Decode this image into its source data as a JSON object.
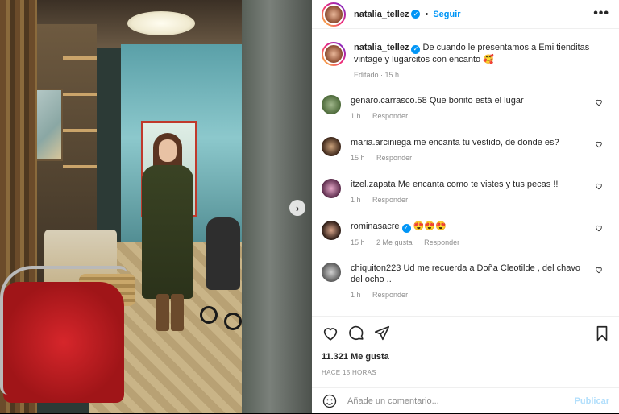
{
  "post": {
    "author": "natalia_tellez",
    "follow_label": "Seguir",
    "more_label": "•••",
    "caption": {
      "author": "natalia_tellez",
      "text": "De cuando le presentamos a Emi tienditas vintage y lugarcitos con encanto 🥰",
      "meta": "Editado · 15 h"
    }
  },
  "comments": [
    {
      "user": "genaro.carrasco.58",
      "text": "Que bonito está el lugar",
      "time": "1 h",
      "likes": "",
      "reply": "Responder",
      "verified": false
    },
    {
      "user": "maria.arciniega",
      "text": "me encanta tu vestido, de donde es?",
      "time": "15 h",
      "likes": "",
      "reply": "Responder",
      "verified": false
    },
    {
      "user": "itzel.zapata",
      "text": "Me encanta como te vistes y tus pecas !!",
      "time": "1 h",
      "likes": "",
      "reply": "Responder",
      "verified": false
    },
    {
      "user": "rominasacre",
      "text": "😍😍😍",
      "time": "15 h",
      "likes": "2 Me gusta",
      "reply": "Responder",
      "verified": true
    },
    {
      "user": "chiquiton223",
      "text": "Ud me recuerda a Doña Cleotilde , del chavo del ocho ..",
      "time": "1 h",
      "likes": "",
      "reply": "Responder",
      "verified": false
    }
  ],
  "engagement": {
    "likes": "11.321 Me gusta",
    "time_ago": "HACE 15 HORAS"
  },
  "composer": {
    "placeholder": "Añade un comentario...",
    "publish_label": "Publicar"
  },
  "colors": {
    "accent": "#0095f6",
    "publish_disabled": "#b2dffc",
    "muted": "#8e8e8e",
    "text": "#262626"
  },
  "icons": {
    "next": "chevron-right-icon",
    "like": "heart-icon",
    "comment": "comment-icon",
    "share": "paper-plane-icon",
    "save": "bookmark-icon",
    "emoji": "smiley-icon",
    "verified": "verified-badge-icon"
  }
}
